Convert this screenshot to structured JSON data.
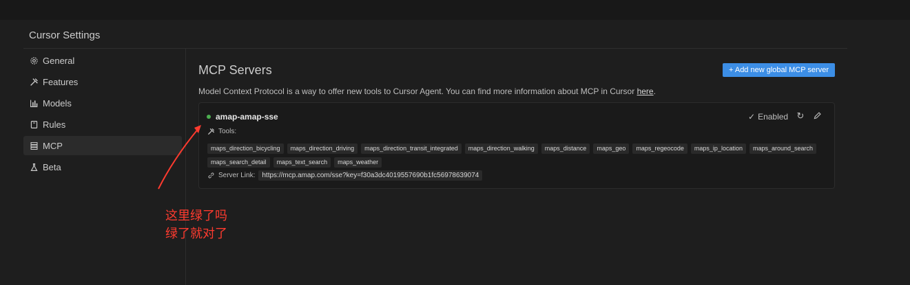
{
  "settings": {
    "title": "Cursor Settings"
  },
  "sidebar": {
    "items": [
      {
        "label": "General",
        "icon": "gear-icon"
      },
      {
        "label": "Features",
        "icon": "tools-icon"
      },
      {
        "label": "Models",
        "icon": "chart-icon"
      },
      {
        "label": "Rules",
        "icon": "book-icon"
      },
      {
        "label": "MCP",
        "icon": "server-icon",
        "active": true
      },
      {
        "label": "Beta",
        "icon": "flask-icon"
      }
    ]
  },
  "main": {
    "title": "MCP Servers",
    "add_button": "+ Add new global MCP server",
    "description": "Model Context Protocol is a way to offer new tools to Cursor Agent. You can find more information about MCP in Cursor ",
    "description_link": "here",
    "description_end": "."
  },
  "server": {
    "name": "amap-amap-sse",
    "status_color": "#4caf50",
    "enabled_label": "Enabled",
    "tools_label": "Tools:",
    "tools": [
      "maps_direction_bicycling",
      "maps_direction_driving",
      "maps_direction_transit_integrated",
      "maps_direction_walking",
      "maps_distance",
      "maps_geo",
      "maps_regeocode",
      "maps_ip_location",
      "maps_around_search",
      "maps_search_detail",
      "maps_text_search",
      "maps_weather"
    ],
    "server_link_label": "Server Link:",
    "server_link": "https://mcp.amap.com/sse?key=f30a3dc4019557690b1fc56978639074"
  },
  "annotation": {
    "line1": "这里绿了吗",
    "line2": "绿了就对了",
    "color": "#ff3b2f"
  }
}
